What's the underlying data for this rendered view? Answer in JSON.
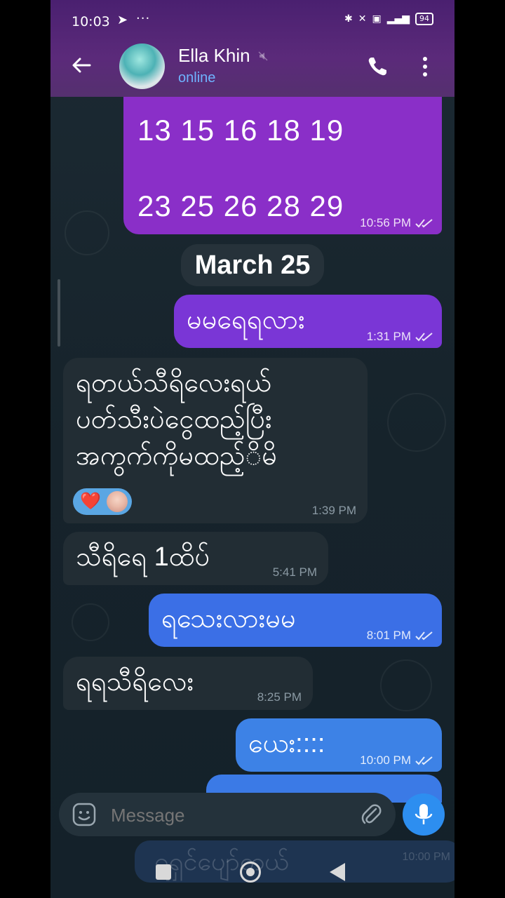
{
  "status_bar": {
    "time": "10:03",
    "send_icon": "telegram-send-icon",
    "more": "···",
    "battery": "94"
  },
  "chat_header": {
    "name": "Ella Khin",
    "status": "online"
  },
  "messages": [
    {
      "direction": "out",
      "lines": [
        "13 15 16 18 19",
        "23 25 26 28 29"
      ],
      "time": "10:56 PM",
      "read": true
    },
    {
      "type": "date",
      "text": "March 25"
    },
    {
      "direction": "out",
      "text": "မမရေရလား",
      "time": "1:31 PM",
      "read": true
    },
    {
      "direction": "in",
      "lines": [
        "ရတယ်သီရိလေးရယ်",
        "ပတ်သီးပဲငွေထည့်ပြီး",
        "အကွက်ကိုမထည့်ိမိ"
      ],
      "time": "1:39 PM",
      "reaction": "❤️"
    },
    {
      "direction": "in",
      "text": "သီရိရေ 1ထိပ်",
      "time": "5:41 PM"
    },
    {
      "direction": "out",
      "text": "ရသေးလားမမ",
      "time": "8:01 PM",
      "read": true
    },
    {
      "direction": "in",
      "text": "ရရသီရိလေး",
      "time": "8:25 PM"
    },
    {
      "direction": "out",
      "text": "ယေး::::",
      "time": "10:00 PM",
      "read": true
    }
  ],
  "composer": {
    "placeholder": "Message"
  },
  "ghost_preview": {
    "text": "ရရှင်ပျော်တယ်",
    "time": "10:00 PM"
  },
  "colors": {
    "header": "#5b2a7a",
    "bubble_purple": "#8a2fc8",
    "bubble_violet": "#7a36d6",
    "bubble_blue": "#3b6fe6",
    "incoming": "#222d34",
    "accent": "#2d8ef0"
  }
}
